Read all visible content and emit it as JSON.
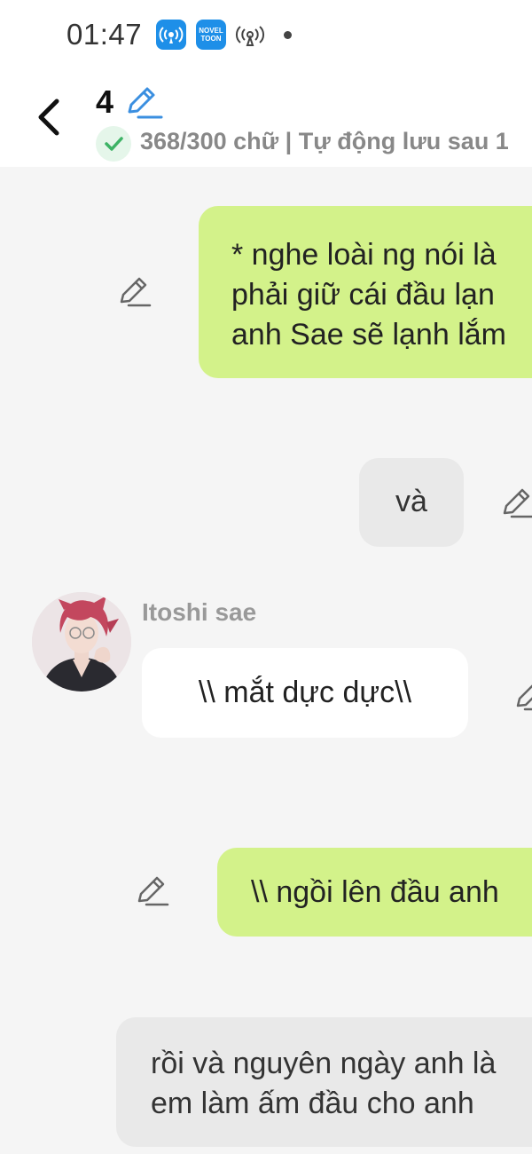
{
  "status_bar": {
    "time": "01:47",
    "notification_badge": "NOVEL\nTOON"
  },
  "header": {
    "chapter_number": "4",
    "autosave_text": "368/300 chữ | Tự động lưu sau 1"
  },
  "messages": [
    {
      "side": "right",
      "type": "narration",
      "lines": [
        "* nghe loài ng nói là",
        "phải giữ cái đầu lạn",
        "anh Sae sẽ lạnh lắm"
      ]
    },
    {
      "side": "right",
      "type": "gray",
      "lines": [
        "và"
      ]
    },
    {
      "side": "left",
      "type": "character",
      "sender": "Itoshi sae",
      "lines": [
        "\\\\ mắt dực dực\\\\"
      ]
    },
    {
      "side": "right",
      "type": "narration",
      "lines": [
        "\\\\ ngồi lên đầu anh"
      ]
    },
    {
      "side": "right",
      "type": "gray",
      "lines": [
        "rồi và nguyên ngày anh là",
        "em làm ấm đầu cho anh"
      ]
    }
  ],
  "colors": {
    "accent_blue": "#1e8fe8",
    "narration_bubble": "#d3f28a",
    "gray_bubble": "#e9e9e9",
    "check_green": "#3db365"
  }
}
